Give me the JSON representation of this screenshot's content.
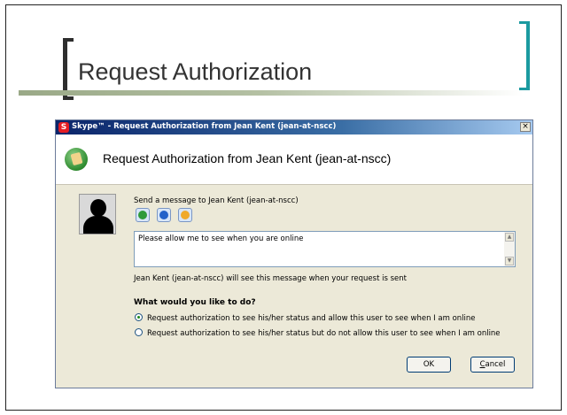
{
  "slide": {
    "title": "Request Authorization",
    "accent_color": "#1b9aa0"
  },
  "dialog": {
    "window_title": "Skype™ - Request Authorization from Jean Kent (jean-at-nscc)",
    "close_glyph": "×",
    "header_title": "Request Authorization from Jean Kent (jean-at-nscc)",
    "send_label": "Send a message to Jean Kent (jean-at-nscc)",
    "emoticons": [
      "smile-icon",
      "info-icon",
      "warning-icon"
    ],
    "message": "Please allow me to see when you are online",
    "notice": "Jean Kent (jean-at-nscc) will see this message when your request is sent",
    "question": "What would you like to do?",
    "options": [
      {
        "label": "Request authorization to see his/her status and allow this user to see when I am online",
        "checked": true
      },
      {
        "label": "Request authorization to see his/her status but do not allow this user to see when I am online",
        "checked": false
      }
    ],
    "ok_label": "OK",
    "cancel_label_underlined": "C",
    "cancel_label_rest": "ancel"
  }
}
